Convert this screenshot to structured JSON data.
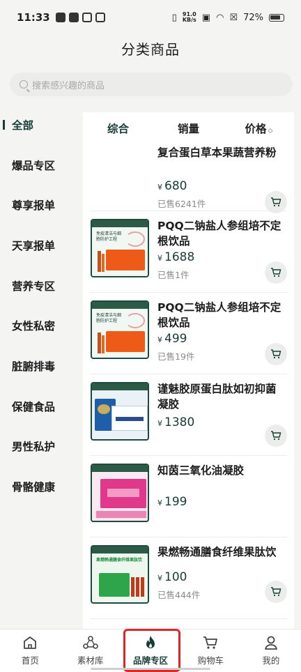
{
  "status": {
    "time": "11:33",
    "net_value": "91.0",
    "net_unit": "KB/s",
    "battery": "72%"
  },
  "header": {
    "title": "分类商品"
  },
  "search": {
    "placeholder": "搜索感兴趣的商品"
  },
  "sidebar": {
    "items": [
      {
        "label": "全部"
      },
      {
        "label": "爆品专区"
      },
      {
        "label": "尊享报单"
      },
      {
        "label": "天享报单"
      },
      {
        "label": "营养专区"
      },
      {
        "label": "女性私密"
      },
      {
        "label": "脏腑排毒"
      },
      {
        "label": "保健食品"
      },
      {
        "label": "男性私护"
      },
      {
        "label": "骨骼健康"
      }
    ]
  },
  "sort": {
    "comprehensive": "综合",
    "sales": "销量",
    "price": "价格",
    "price_arrow": "◇"
  },
  "products": [
    {
      "title": "复合蛋白草本果蔬营养粉",
      "yen": "¥",
      "price": "680",
      "sold": "已售6241件"
    },
    {
      "title": "PQQ二钠盐人参组培不定根饮品",
      "yen": "¥",
      "price": "1688",
      "sold": "已售1件",
      "thumb_text": "免疫清洁与细胞防护工程"
    },
    {
      "title": "PQQ二钠盐人参组培不定根饮品",
      "yen": "¥",
      "price": "499",
      "sold": "已售19件",
      "thumb_text": "免疫清洁与细胞防护工程"
    },
    {
      "title": "谨魅胶原蛋白肽如初抑菌凝胶",
      "yen": "¥",
      "price": "1380",
      "sold": ""
    },
    {
      "title": "知茵三氧化油凝胶",
      "yen": "¥",
      "price": "199",
      "sold": ""
    },
    {
      "title": "果燃畅通膳食纤维果肽饮",
      "yen": "¥",
      "price": "100",
      "sold": "已售444件",
      "thumb_text": "果燃畅通膳食纤维果肽饮"
    }
  ],
  "tabbar": {
    "home": "首页",
    "materials": "素材库",
    "brand": "品牌专区",
    "cart": "购物车",
    "mine": "我的"
  },
  "colors": {
    "accent": "#173c36",
    "highlight": "#e02525"
  }
}
